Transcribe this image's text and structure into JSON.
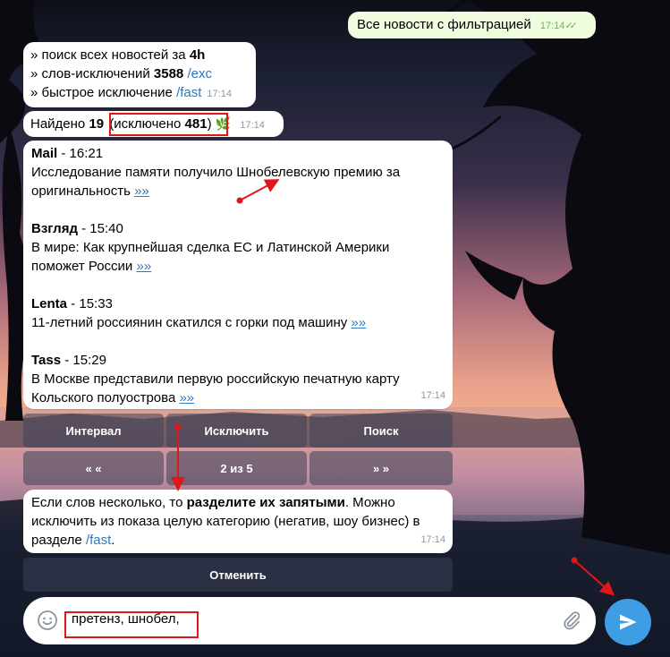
{
  "outgoing": {
    "text": "Все новости с фильтрацией",
    "time": "17:14"
  },
  "info": {
    "line1_prefix": "» поиск всех новостей за ",
    "line1_bold": "4h",
    "line2_prefix": "» слов-исключений ",
    "line2_bold": "3588",
    "line2_link": "/exc",
    "line3_prefix": "» быстрое исключение ",
    "line3_link": "/fast",
    "time": "17:14"
  },
  "found": {
    "prefix": "Найдено ",
    "count": "19",
    "excluded_prefix": "(исключено ",
    "excluded_count": "481",
    "excluded_suffix": ")",
    "time": "17:14"
  },
  "news": {
    "items": [
      {
        "source": "Mail",
        "time_sep": " - 16:21",
        "text": "Исследование памяти получило Шнобелевскую премию за оригинальность ",
        "more": "»»"
      },
      {
        "source": "Взгляд",
        "time_sep": " - 15:40",
        "text": "В мире: Как крупнейшая сделка ЕС и Латинской Америки поможет России ",
        "more": "»»"
      },
      {
        "source": "Lenta",
        "time_sep": " - 15:33",
        "text": "11-летний россиянин скатился с горки под машину ",
        "more": "»»"
      },
      {
        "source": "Tass",
        "time_sep": " - 15:29",
        "text": "В Москве представили первую российскую печатную карту Кольского полуострова ",
        "more": "»»"
      }
    ],
    "time": "17:14"
  },
  "keyboard": {
    "row1": [
      "Интервал",
      "Исключить",
      "Поиск"
    ],
    "row2": [
      "« «",
      "2 из 5",
      "» »"
    ]
  },
  "hint": {
    "part1": "Если слов несколько, то ",
    "bold": "разделите их запятыми",
    "part2": ". Можно исключить из показа целую категорию (негатив, шоу бизнес) в разделе ",
    "link": "/fast",
    "part3": ".",
    "time": "17:14"
  },
  "cancel_button": "Отменить",
  "composer": {
    "value": "претенз, шнобел,",
    "emoji_icon": "smile-icon",
    "attach_icon": "paperclip-icon",
    "send_icon": "send-icon"
  },
  "colors": {
    "annotation": "#e0161b",
    "link": "#2a79c7",
    "send": "#3e9de3",
    "outgoing_bubble": "#effdde"
  }
}
